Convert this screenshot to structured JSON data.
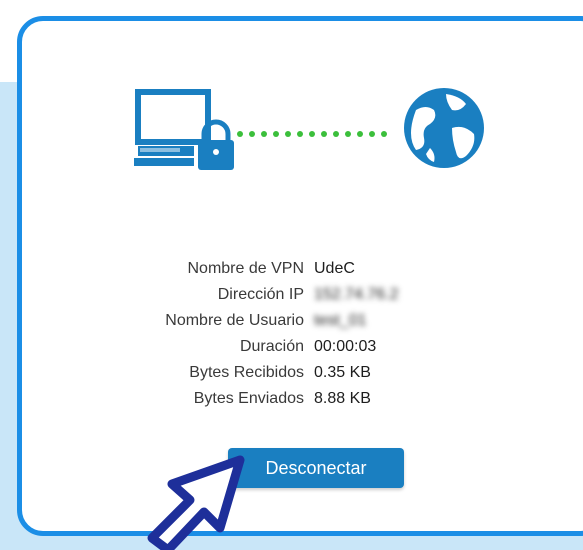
{
  "colors": {
    "accent": "#1a7fc1",
    "card_border": "#1b8ee6",
    "connection_dots": "#3bbf3b",
    "background_band": "#c9e6f8"
  },
  "illustration": {
    "left_icon": "computer-with-lock-icon",
    "right_icon": "globe-icon",
    "link": "dotted-connection-line"
  },
  "vpn_info": [
    {
      "label": "Nombre de VPN",
      "value": "UdeC"
    },
    {
      "label": "Dirección IP",
      "value": "152.74.76.2"
    },
    {
      "label": "Nombre de Usuario",
      "value": "test_01"
    },
    {
      "label": "Duración",
      "value": "00:00:03"
    },
    {
      "label": "Bytes Recibidos",
      "value": "0.35 KB"
    },
    {
      "label": "Bytes Enviados",
      "value": "8.88 KB"
    }
  ],
  "disconnect_button": {
    "label": "Desconectar"
  },
  "cursor_icon": "arrow-pointer-icon"
}
